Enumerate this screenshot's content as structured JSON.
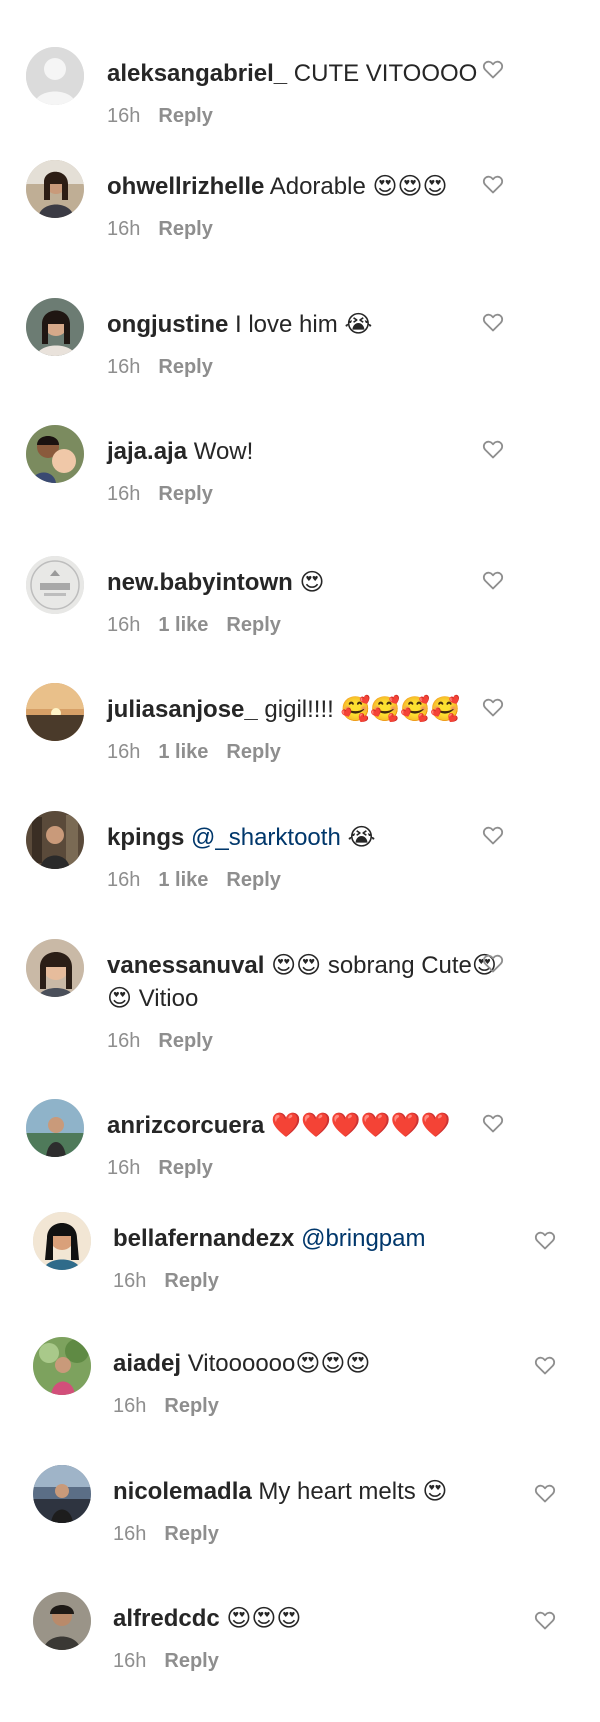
{
  "colors": {
    "username": "#262626",
    "meta": "#8e8e8e",
    "mention": "#00376b",
    "heart_outline": "#8e8e8e"
  },
  "icons": {
    "like": "heart-outline-icon"
  },
  "comments": [
    {
      "username": "aleksangabriel_",
      "text": " CUTE VITOOOO",
      "time": "16h",
      "likes": "",
      "reply": "Reply"
    },
    {
      "username": "ohwellrizhelle",
      "text": " Adorable 😍😍😍",
      "time": "16h",
      "likes": "",
      "reply": "Reply"
    },
    {
      "username": "ongjustine",
      "text": " I love him 😭",
      "time": "16h",
      "likes": "",
      "reply": "Reply"
    },
    {
      "username": "jaja.aja",
      "text": " Wow!",
      "time": "16h",
      "likes": "",
      "reply": "Reply"
    },
    {
      "username": "new.babyintown",
      "text": " 😍",
      "time": "16h",
      "likes": "1 like",
      "reply": "Reply"
    },
    {
      "username": "juliasanjose_",
      "text": " gigil!!!! 🥰🥰🥰🥰",
      "time": "16h",
      "likes": "1 like",
      "reply": "Reply"
    },
    {
      "username": "kpings",
      "text": "",
      "mention": "@_sharktooth",
      "text_after": " 😭",
      "time": "16h",
      "likes": "1 like",
      "reply": "Reply"
    },
    {
      "username": "vanessanuval",
      "text": " 😍😍 sobrang Cute😍😍 Vitioo",
      "time": "16h",
      "likes": "",
      "reply": "Reply"
    },
    {
      "username": "anrizcorcuera",
      "text": " ❤️❤️❤️❤️❤️❤️",
      "time": "16h",
      "likes": "",
      "reply": "Reply"
    },
    {
      "username": "bellafernandezx",
      "text": "",
      "mention": "@bringpam",
      "text_after": "",
      "time": "16h",
      "likes": "",
      "reply": "Reply"
    },
    {
      "username": "aiadej",
      "text": " Vitoooooo😍😍😍",
      "time": "16h",
      "likes": "",
      "reply": "Reply"
    },
    {
      "username": "nicolemadla",
      "text": " My heart melts 😍",
      "time": "16h",
      "likes": "",
      "reply": "Reply"
    },
    {
      "username": "alfredcdc",
      "text": " 😍😍😍",
      "time": "16h",
      "likes": "",
      "reply": "Reply"
    }
  ]
}
